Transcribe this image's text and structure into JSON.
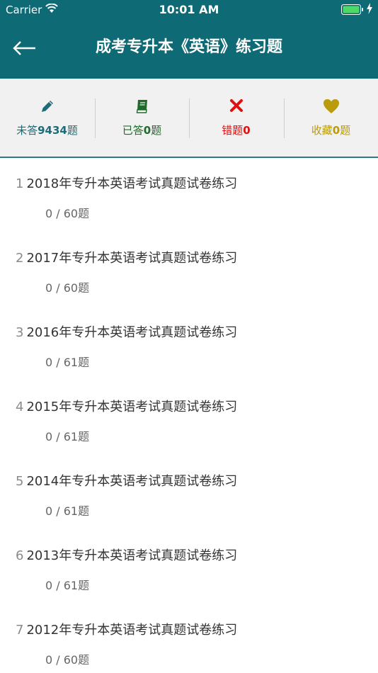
{
  "status_bar": {
    "carrier": "Carrier",
    "time": "10:01 AM"
  },
  "nav": {
    "title": "成考专升本《英语》练习题"
  },
  "stats": [
    {
      "prefix": "未答",
      "count": "9434",
      "suffix": "题",
      "color": "#1d6c77",
      "icon": "pencil-icon"
    },
    {
      "prefix": "已答",
      "count": "0",
      "suffix": "题",
      "color": "#1f6b2a",
      "icon": "book-icon"
    },
    {
      "prefix": "错题",
      "count": "0",
      "suffix": "",
      "color": "#e01010",
      "icon": "x-icon"
    },
    {
      "prefix": "收藏",
      "count": "0",
      "suffix": "题",
      "color": "#b99b0c",
      "icon": "heart-icon"
    }
  ],
  "exams": [
    {
      "num": "1",
      "title": "2018年专升本英语考试真题试卷练习",
      "progress": "0 / 60题"
    },
    {
      "num": "2",
      "title": "2017年专升本英语考试真题试卷练习",
      "progress": "0 / 60题"
    },
    {
      "num": "3",
      "title": "2016年专升本英语考试真题试卷练习",
      "progress": "0 / 61题"
    },
    {
      "num": "4",
      "title": "2015年专升本英语考试真题试卷练习",
      "progress": "0 / 61题"
    },
    {
      "num": "5",
      "title": "2014年专升本英语考试真题试卷练习",
      "progress": "0 / 61题"
    },
    {
      "num": "6",
      "title": "2013年专升本英语考试真题试卷练习",
      "progress": "0 / 61题"
    },
    {
      "num": "7",
      "title": "2012年专升本英语考试真题试卷练习",
      "progress": "0 / 60题"
    }
  ]
}
